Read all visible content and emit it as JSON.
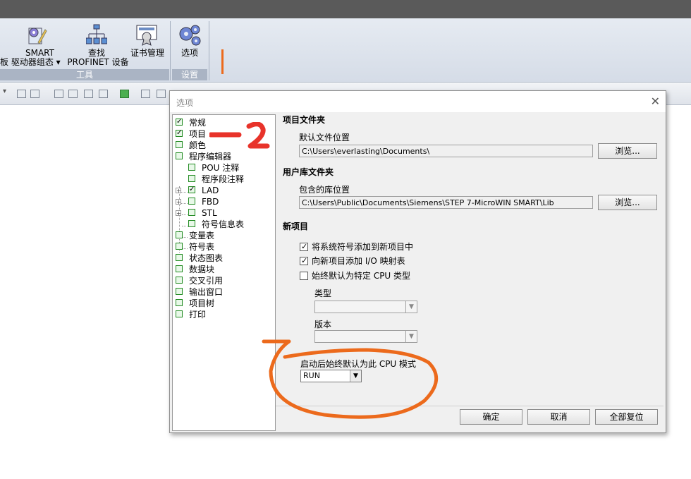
{
  "ribbon": {
    "tools_group": {
      "label": "工具",
      "items": [
        {
          "line1": "SMART",
          "line2": "板 驱动器组态 ▾",
          "icon": "smart-drive-config-icon"
        },
        {
          "line1": "查找",
          "line2": "PROFINET 设备",
          "icon": "find-profinet-icon"
        },
        {
          "line1": "证书管理",
          "line2": "",
          "icon": "certificate-icon"
        }
      ]
    },
    "settings_group": {
      "label": "设置",
      "items": [
        {
          "line1": "选项",
          "icon": "options-gears-icon"
        }
      ]
    }
  },
  "dialog": {
    "title": "选项",
    "close_glyph": "✕",
    "tree": [
      {
        "label": "常规",
        "checked": true
      },
      {
        "label": "项目",
        "checked": true
      },
      {
        "label": "颜色",
        "checked": false
      },
      {
        "label": "程序编辑器",
        "checked": false
      },
      {
        "label": "POU 注释",
        "checked": false
      },
      {
        "label": "程序段注释",
        "checked": false
      },
      {
        "label": "LAD",
        "checked": true
      },
      {
        "label": "FBD",
        "checked": false
      },
      {
        "label": "STL",
        "checked": false
      },
      {
        "label": "符号信息表",
        "checked": false
      },
      {
        "label": "变量表",
        "checked": false
      },
      {
        "label": "符号表",
        "checked": false
      },
      {
        "label": "状态图表",
        "checked": false
      },
      {
        "label": "数据块",
        "checked": false
      },
      {
        "label": "交叉引用",
        "checked": false
      },
      {
        "label": "输出窗口",
        "checked": false
      },
      {
        "label": "项目树",
        "checked": false
      },
      {
        "label": "打印",
        "checked": false
      }
    ],
    "project_folder": {
      "title": "项目文件夹",
      "default_location_label": "默认文件位置",
      "default_location_value": "C:\\Users\\everlasting\\Documents\\",
      "browse_label": "浏览..."
    },
    "library_folder": {
      "title": "用户库文件夹",
      "contained_label": "包含的库位置",
      "contained_value": "C:\\Users\\Public\\Documents\\Siemens\\STEP 7-MicroWIN SMART\\Lib",
      "browse_label": "浏览..."
    },
    "new_project": {
      "title": "新项目",
      "options": [
        {
          "label": "将系统符号添加到新项目中",
          "checked": true
        },
        {
          "label": "向新项目添加 I/O 映射表",
          "checked": true
        },
        {
          "label": "始终默认为特定 CPU 类型",
          "checked": false
        }
      ],
      "type_label": "类型",
      "version_label": "版本",
      "cpu_mode_label": "启动后始终默认为此 CPU 模式",
      "cpu_mode_value": "RUN"
    },
    "buttons": {
      "ok": "确定",
      "cancel": "取消",
      "reset_all": "全部复位"
    }
  },
  "annotations": {
    "handwritten_number": "2",
    "accent_color": "#ec6a1c"
  }
}
